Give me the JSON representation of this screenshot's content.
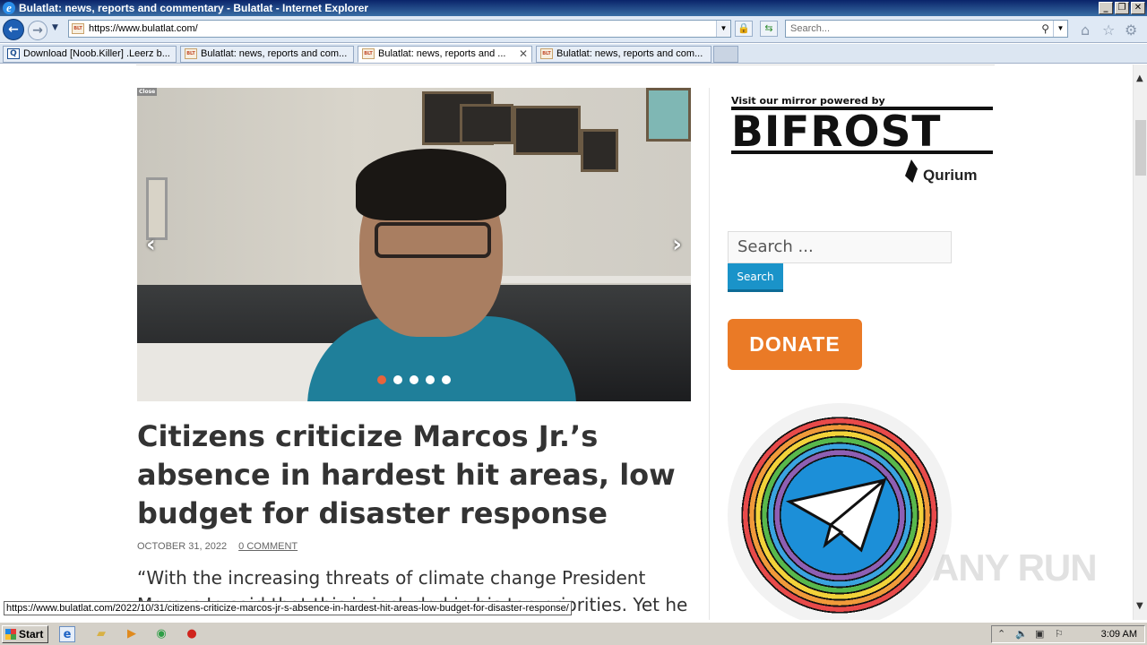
{
  "window": {
    "title": "Bulatlat: news, reports and commentary - Bulatlat - Internet Explorer",
    "controls": [
      "_",
      "❐",
      "✕"
    ]
  },
  "navbar": {
    "address": "https://www.bulatlat.com/",
    "search_placeholder": "Search..."
  },
  "tabs": [
    {
      "label": "Download [Noob.Killer] .Leerz b...",
      "active": false,
      "icon": "download-icon"
    },
    {
      "label": "Bulatlat: news, reports and com...",
      "active": false,
      "icon": "bulatlat-favicon"
    },
    {
      "label": "Bulatlat: news, reports and ...",
      "active": true,
      "icon": "bulatlat-favicon"
    },
    {
      "label": "Bulatlat: news, reports and com...",
      "active": false,
      "icon": "bulatlat-favicon"
    }
  ],
  "slider": {
    "close_label": "Close",
    "dots": 5,
    "active_dot": 0
  },
  "article": {
    "headline": "Citizens criticize Marcos Jr.’s absence in hardest hit areas, low budget for disaster response",
    "date": "OCTOBER 31, 2022",
    "comments": "0 COMMENT",
    "excerpt": "“With the increasing threats of climate change President Marcos Jr. said that this is included in his top priorities. Yet he cuts the"
  },
  "sidebar": {
    "mirror_caption": "Visit our mirror powered by",
    "bifrost_word": "BIFROST",
    "qurium": "Qurium",
    "search_placeholder": "Search ...",
    "search_button": "Search",
    "donate": "DONATE"
  },
  "status_url": "https://www.bulatlat.com/2022/10/31/citizens-criticize-marcos-jr-s-absence-in-hardest-hit-areas-low-budget-for-disaster-response/",
  "taskbar": {
    "start": "Start",
    "clock": "3:09 AM"
  },
  "watermark": "ANY RUN"
}
